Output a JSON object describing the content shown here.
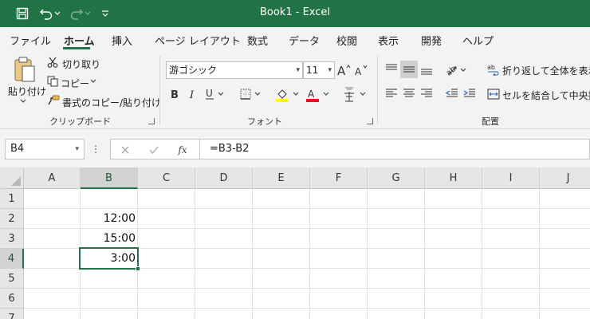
{
  "window": {
    "title": "Book1  -  Excel"
  },
  "ribbon_tabs": [
    "ファイル",
    "ホーム",
    "挿入",
    "ページ レイアウト",
    "数式",
    "データ",
    "校閲",
    "表示",
    "開発",
    "ヘルプ"
  ],
  "active_tab": "ホーム",
  "clipboard": {
    "paste": "貼り付け",
    "cut": "切り取り",
    "copy": "コピー",
    "format_painter": "書式のコピー/貼り付け",
    "group_label": "クリップボード"
  },
  "font": {
    "name": "游ゴシック",
    "size": "11",
    "group_label": "フォント"
  },
  "alignment": {
    "wrap_text": "折り返して全体を表示す",
    "merge_center": "セルを結合して中央揃え",
    "group_label": "配置"
  },
  "formula_bar": {
    "name_box": "B4",
    "formula": "=B3-B2",
    "fx": "fx"
  },
  "columns": [
    "A",
    "B",
    "C",
    "D",
    "E",
    "F",
    "G",
    "H",
    "I",
    "J"
  ],
  "rows": [
    "1",
    "2",
    "3",
    "4",
    "5",
    "6",
    "7"
  ],
  "cells": {
    "B2": "12:00",
    "B3": "15:00",
    "B4": "3:00"
  },
  "selected_cell": "B4",
  "colors": {
    "accent": "#217346"
  }
}
